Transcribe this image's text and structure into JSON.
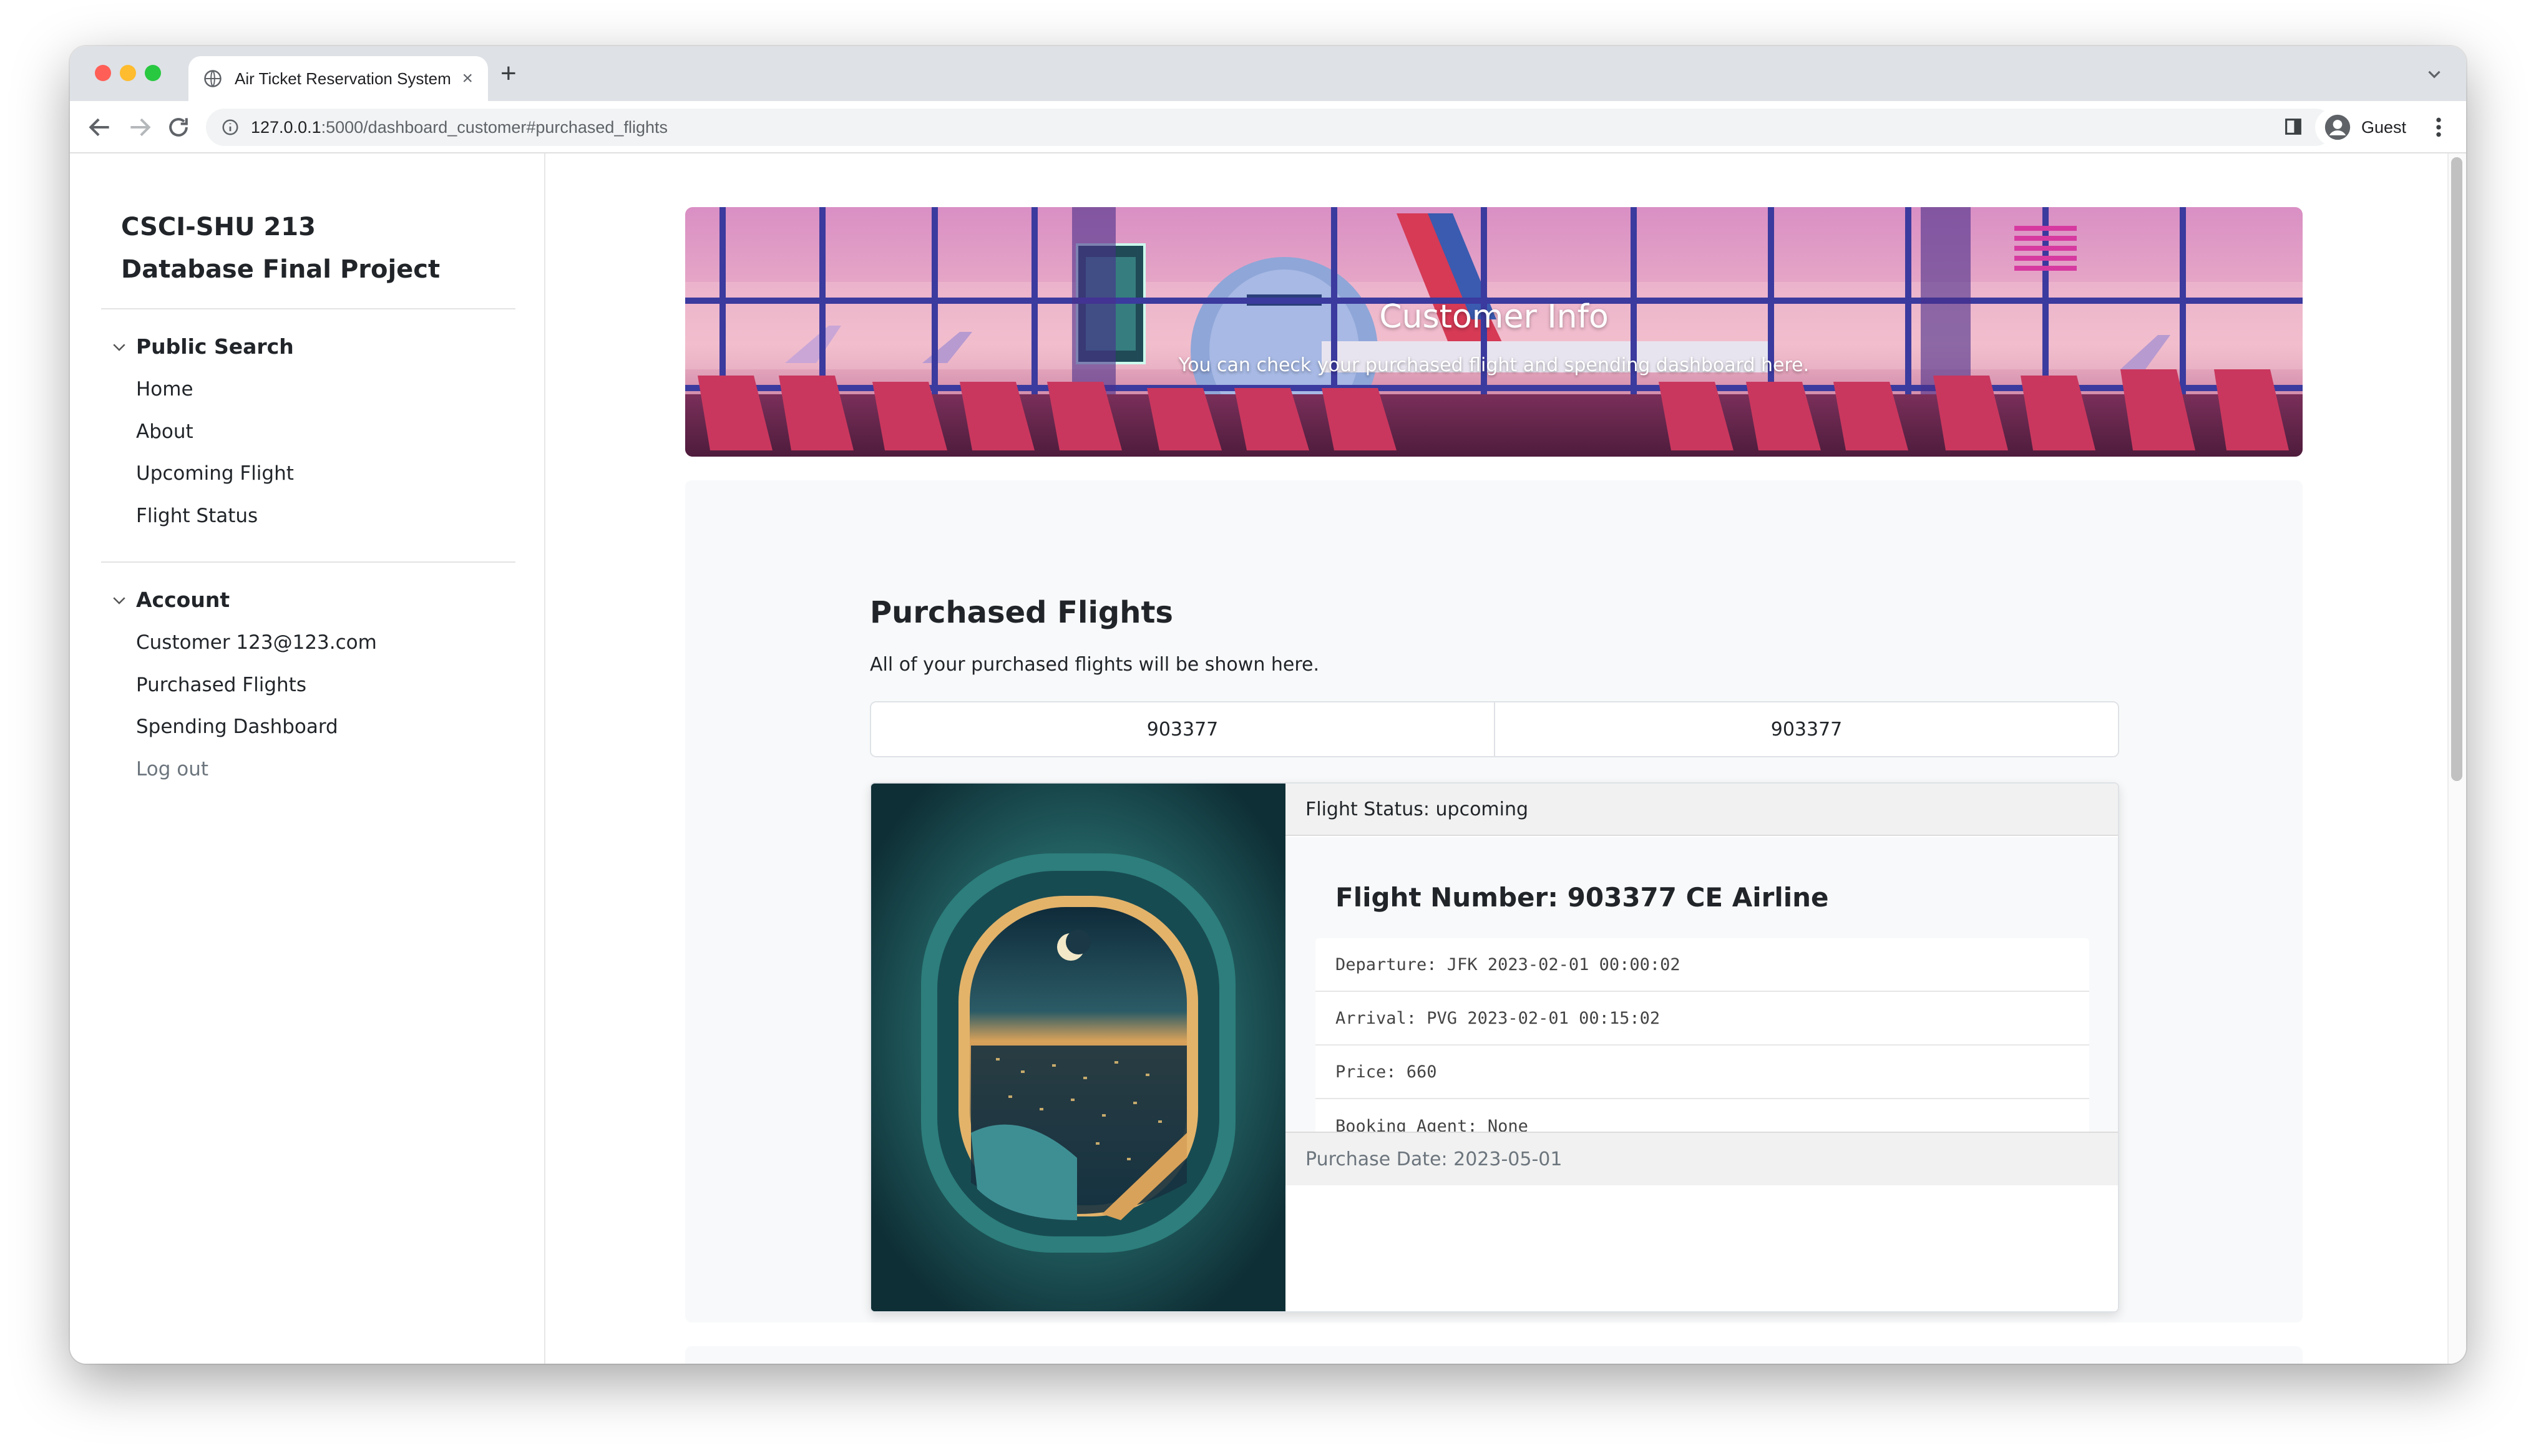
{
  "browser": {
    "tab_title": "Air Ticket Reservation System",
    "url_host": "127.0.0.1",
    "url_rest": ":5000/dashboard_customer#purchased_flights",
    "profile_label": "Guest"
  },
  "sidebar": {
    "brand_line1": "CSCI-SHU 213",
    "brand_line2": "Database Final Project",
    "public_search": {
      "heading": "Public Search",
      "items": [
        "Home",
        "About",
        "Upcoming Flight",
        "Flight Status"
      ]
    },
    "account": {
      "heading": "Account",
      "items": [
        "Customer 123@123.com",
        "Purchased Flights",
        "Spending Dashboard",
        "Log out"
      ]
    }
  },
  "hero": {
    "title": "Customer Info",
    "subtitle": "You can check your purchased flight and spending dashboard here."
  },
  "purchased": {
    "title": "Purchased Flights",
    "description": "All of your purchased flights will be shown here.",
    "tabs": [
      "903377",
      "903377"
    ]
  },
  "flight_card": {
    "status": "Flight Status: upcoming",
    "title": "Flight Number: 903377 CE Airline",
    "details": [
      "Departure: JFK 2023-02-01 00:00:02",
      "Arrival: PVG 2023-02-01 00:15:02",
      "Price: 660",
      "Booking Agent: None"
    ],
    "purchase_date": "Purchase Date: 2023-05-01"
  },
  "colors": {
    "traffic_red": "#ff5f57",
    "traffic_yellow": "#febc2e",
    "traffic_green": "#28c840",
    "panel_bg": "#f8f9fa",
    "text_dark": "#212529"
  },
  "icons": [
    "globe-icon",
    "close-icon",
    "plus-icon",
    "back-icon",
    "forward-icon",
    "reload-icon",
    "info-icon",
    "side-panel-icon",
    "avatar-icon",
    "kebab-menu-icon",
    "chevron-down-icon"
  ]
}
